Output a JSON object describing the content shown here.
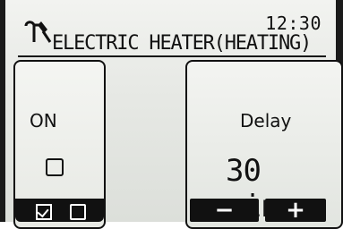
{
  "header": {
    "clock": "12:30",
    "title": "ELECTRIC HEATER(HEATING)"
  },
  "left_panel": {
    "status_label": "ON",
    "checkbox_checked": false
  },
  "right_panel": {
    "setting_label": "Delay",
    "value": "30 min."
  },
  "buttons": {
    "minus": "−",
    "plus": "+"
  },
  "icons": {
    "tools": "wrench-screwdriver-icon"
  }
}
